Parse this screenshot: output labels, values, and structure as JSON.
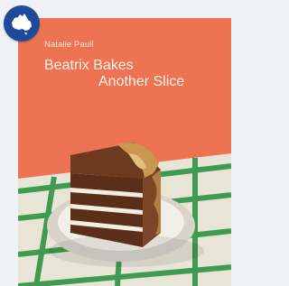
{
  "book": {
    "author": "Natalie Paull",
    "title_line_1": "Beatrix Bakes",
    "title_line_2": "Another Slice"
  },
  "badge": {
    "icon": "australia-map-icon",
    "background_color": "#1e4a9b"
  },
  "colors": {
    "cover_background": "#ed7352",
    "tablecloth_green": "#3f9b4f"
  }
}
